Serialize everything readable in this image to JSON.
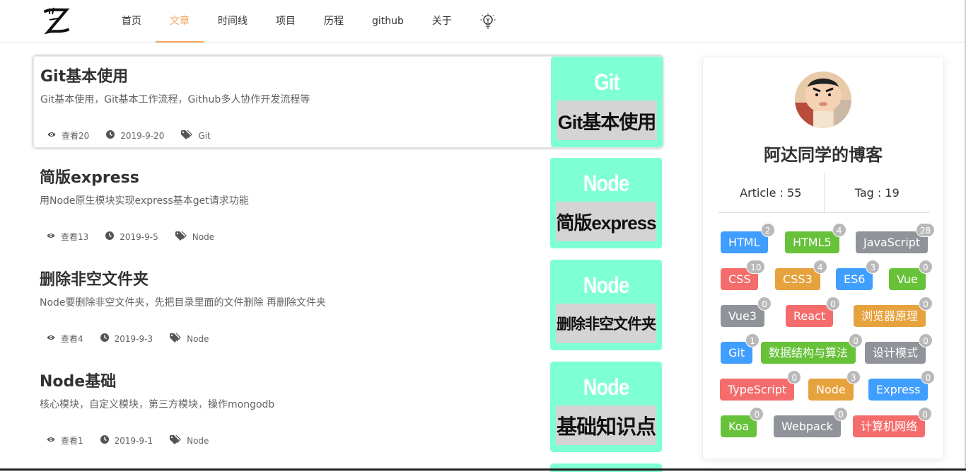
{
  "header": {
    "logo_letter": "Z",
    "nav": [
      {
        "label": "首页",
        "active": false
      },
      {
        "label": "文章",
        "active": true
      },
      {
        "label": "时间线",
        "active": false
      },
      {
        "label": "项目",
        "active": false
      },
      {
        "label": "历程",
        "active": false
      },
      {
        "label": "github",
        "active": false
      },
      {
        "label": "关于",
        "active": false
      }
    ],
    "theme_toggle_icon": "lightbulb-icon"
  },
  "articles": [
    {
      "title": "Git基本使用",
      "desc": "Git基本使用，Git基本工作流程，Github多人协作开发流程等",
      "views": "查看20",
      "date": "2019-9-20",
      "tag": "Git",
      "thumb_top": "Git",
      "thumb_bottom": "Git基本使用",
      "hovered": true
    },
    {
      "title": "简版express",
      "desc": "用Node原生模块实现express基本get请求功能",
      "views": "查看13",
      "date": "2019-9-5",
      "tag": "Node",
      "thumb_top": "Node",
      "thumb_bottom": "简版express",
      "hovered": false
    },
    {
      "title": "删除非空文件夹",
      "desc": "Node要删除非空文件夹，先把目录里面的文件删除 再删除文件夹",
      "views": "查看4",
      "date": "2019-9-3",
      "tag": "Node",
      "thumb_top": "Node",
      "thumb_bottom": "删除非空文件夹",
      "hovered": false
    },
    {
      "title": "Node基础",
      "desc": "核心模块，自定义模块，第三方模块，操作mongodb",
      "views": "查看1",
      "date": "2019-9-1",
      "tag": "Node",
      "thumb_top": "Node",
      "thumb_bottom": "基础知识点",
      "hovered": false
    }
  ],
  "sidebar": {
    "blog_name": "阿达同学的博客",
    "article_stat": "Article : 55",
    "tag_stat": "Tag : 19",
    "tags": [
      {
        "name": "HTML",
        "count": "2",
        "color": "#409eff"
      },
      {
        "name": "HTML5",
        "count": "4",
        "color": "#67c23a"
      },
      {
        "name": "JavaScript",
        "count": "28",
        "color": "#909399"
      },
      {
        "name": "CSS",
        "count": "10",
        "color": "#f56c6c"
      },
      {
        "name": "CSS3",
        "count": "4",
        "color": "#e6a23c"
      },
      {
        "name": "ES6",
        "count": "3",
        "color": "#409eff"
      },
      {
        "name": "Vue",
        "count": "0",
        "color": "#67c23a"
      },
      {
        "name": "Vue3",
        "count": "0",
        "color": "#909399"
      },
      {
        "name": "React",
        "count": "0",
        "color": "#f56c6c"
      },
      {
        "name": "浏览器原理",
        "count": "0",
        "color": "#e6a23c"
      },
      {
        "name": "Git",
        "count": "1",
        "color": "#409eff"
      },
      {
        "name": "数据结构与算法",
        "count": "0",
        "color": "#67c23a"
      },
      {
        "name": "设计模式",
        "count": "0",
        "color": "#909399"
      },
      {
        "name": "TypeScript",
        "count": "0",
        "color": "#f56c6c"
      },
      {
        "name": "Node",
        "count": "3",
        "color": "#e6a23c"
      },
      {
        "name": "Express",
        "count": "0",
        "color": "#409eff"
      },
      {
        "name": "Koa",
        "count": "0",
        "color": "#67c23a"
      },
      {
        "name": "Webpack",
        "count": "0",
        "color": "#909399"
      },
      {
        "name": "计算机网络",
        "count": "0",
        "color": "#f56c6c"
      }
    ]
  }
}
